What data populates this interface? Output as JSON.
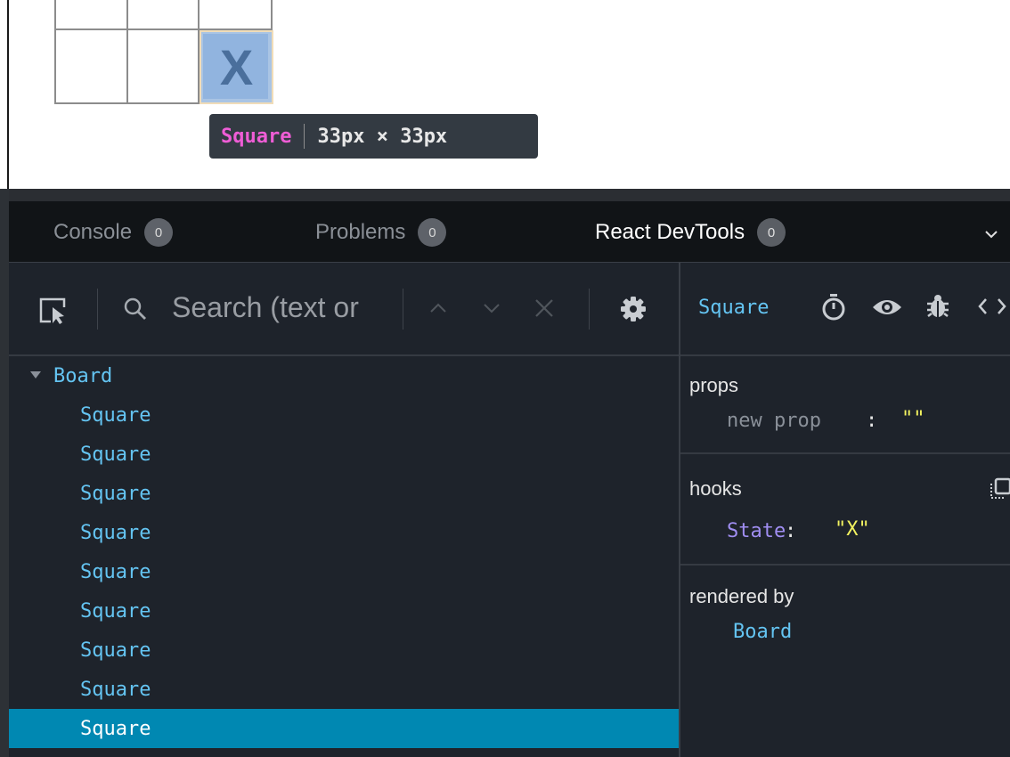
{
  "preview": {
    "cell_value": "X",
    "highlight": {
      "component": "Square",
      "dimensions": "33px × 33px"
    }
  },
  "panel_tabs": [
    {
      "label": "Console",
      "count": "0"
    },
    {
      "label": "Problems",
      "count": "0"
    },
    {
      "label": "React DevTools",
      "count": "0",
      "active": true
    }
  ],
  "toolbar": {
    "search_placeholder": "Search (text or"
  },
  "tree": [
    {
      "label": "Board",
      "expanded": true
    },
    {
      "label": "Square"
    },
    {
      "label": "Square"
    },
    {
      "label": "Square"
    },
    {
      "label": "Square"
    },
    {
      "label": "Square"
    },
    {
      "label": "Square"
    },
    {
      "label": "Square"
    },
    {
      "label": "Square"
    },
    {
      "label": "Square",
      "selected": true
    }
  ],
  "inspector": {
    "component": "Square",
    "props": {
      "title": "props",
      "new_prop_key": "new prop",
      "colon": ":",
      "new_prop_value": "\"\""
    },
    "hooks": {
      "title": "hooks",
      "name": "State",
      "colon": ":",
      "value": "\"X\""
    },
    "rendered_by": {
      "title": "rendered by",
      "owner": "Board"
    }
  },
  "colors": {
    "accent": "#64c4f2",
    "selected_row": "#0088b2",
    "component_name_tooltip": "#ef5dd6",
    "hook_name": "#a08ef2",
    "string_value": "#f3f360"
  }
}
